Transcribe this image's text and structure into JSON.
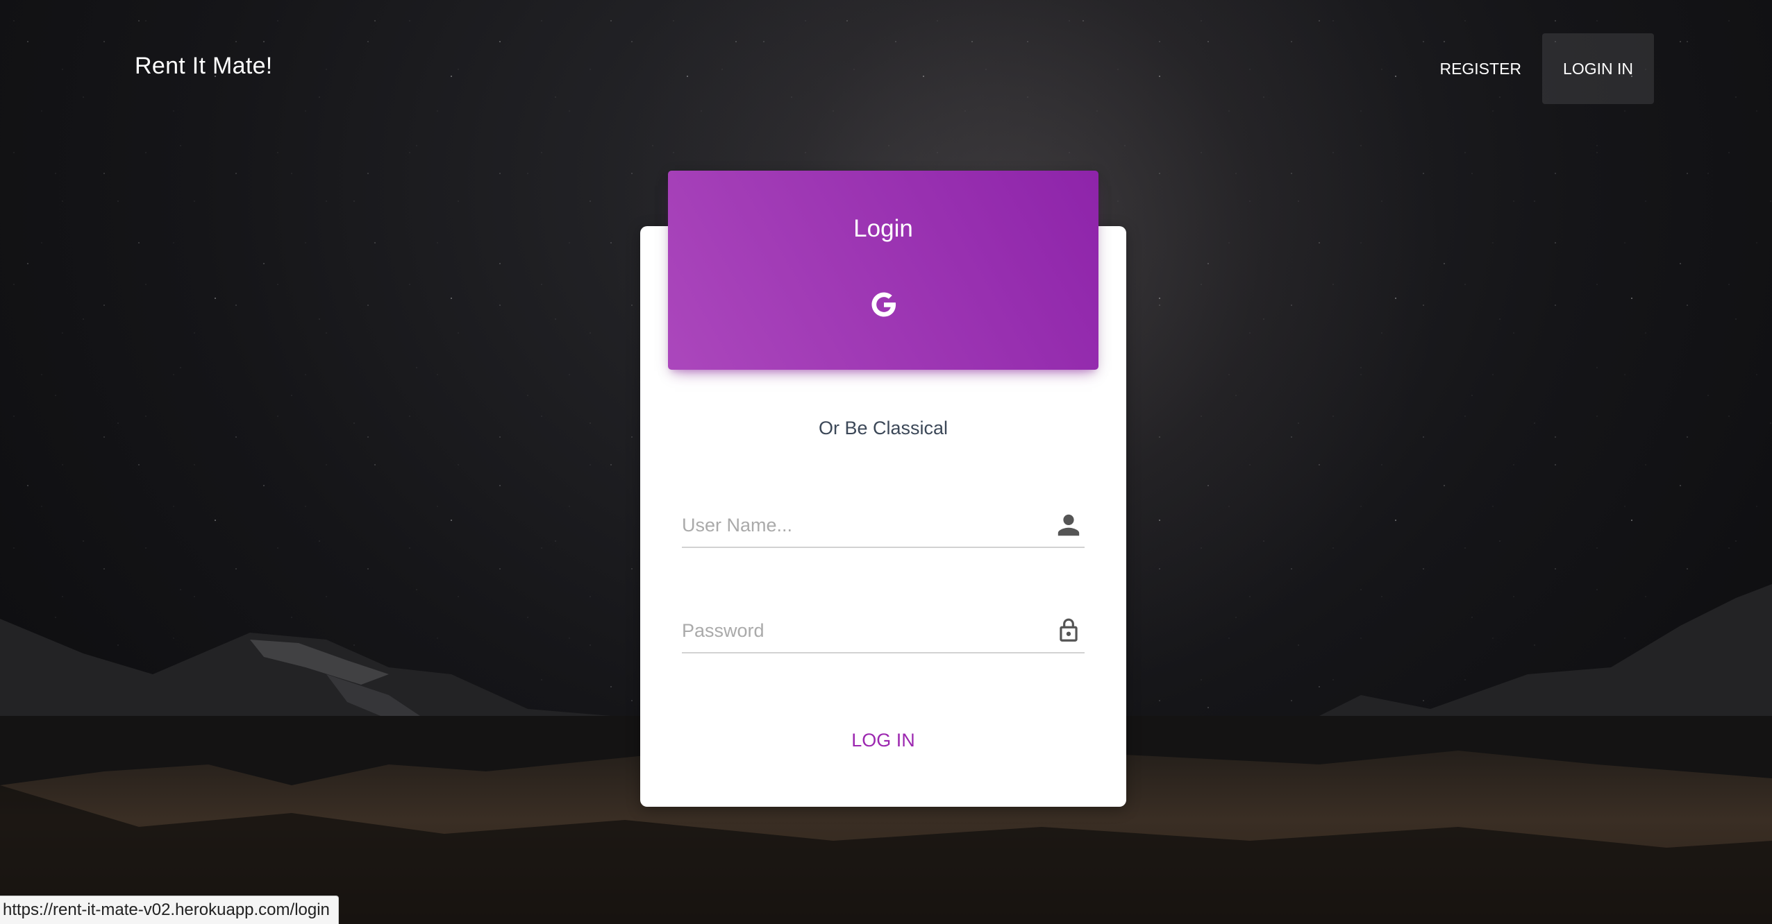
{
  "app": {
    "brand": "Rent It Mate!"
  },
  "nav": {
    "register": "REGISTER",
    "login": "LOGIN IN"
  },
  "card": {
    "title": "Login",
    "social_icon": "google-icon",
    "subtitle": "Or Be Classical",
    "username_placeholder": "User Name...",
    "username_value": "",
    "username_icon": "person-icon",
    "password_placeholder": "Password",
    "password_value": "",
    "password_icon": "lock-icon",
    "submit_label": "LOG IN"
  },
  "status_bar": {
    "url": "https://rent-it-mate-v02.herokuapp.com/login"
  },
  "colors": {
    "accent": "#9c27b0",
    "header_gradient_start": "#ab47bc",
    "header_gradient_end": "#8e24aa"
  }
}
